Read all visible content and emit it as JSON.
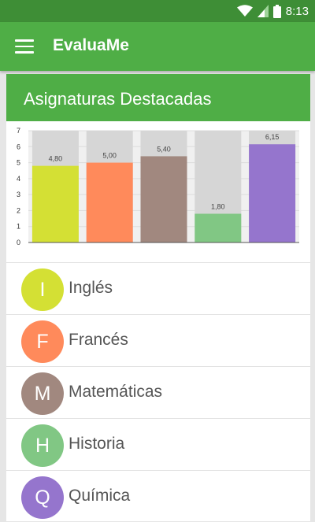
{
  "status_bar": {
    "time": "8:13"
  },
  "toolbar": {
    "title": "EvaluaMe"
  },
  "card": {
    "title": "Asignaturas Destacadas"
  },
  "chart_data": {
    "type": "bar",
    "categories": [
      "Inglés",
      "Francés",
      "Matemáticas",
      "Historia",
      "Química"
    ],
    "values": [
      4.8,
      5.0,
      5.4,
      1.8,
      6.15
    ],
    "value_labels": [
      "4,80",
      "5,00",
      "5,40",
      "1,80",
      "6,15"
    ],
    "colors": [
      "#d4e034",
      "#ff8a5b",
      "#a1887f",
      "#81c784",
      "#9575cd"
    ],
    "ylim": [
      0,
      7
    ],
    "yticks": [
      0,
      1,
      2,
      3,
      4,
      5,
      6,
      7
    ],
    "grid": true,
    "background_bar_color": "#d6d6d6"
  },
  "subjects": [
    {
      "letter": "I",
      "name": "Inglés",
      "color": "#d4e034"
    },
    {
      "letter": "F",
      "name": "Francés",
      "color": "#ff8a5b"
    },
    {
      "letter": "M",
      "name": "Matemáticas",
      "color": "#a1887f"
    },
    {
      "letter": "H",
      "name": "Historia",
      "color": "#81c784"
    },
    {
      "letter": "Q",
      "name": "Química",
      "color": "#9575cd"
    }
  ]
}
